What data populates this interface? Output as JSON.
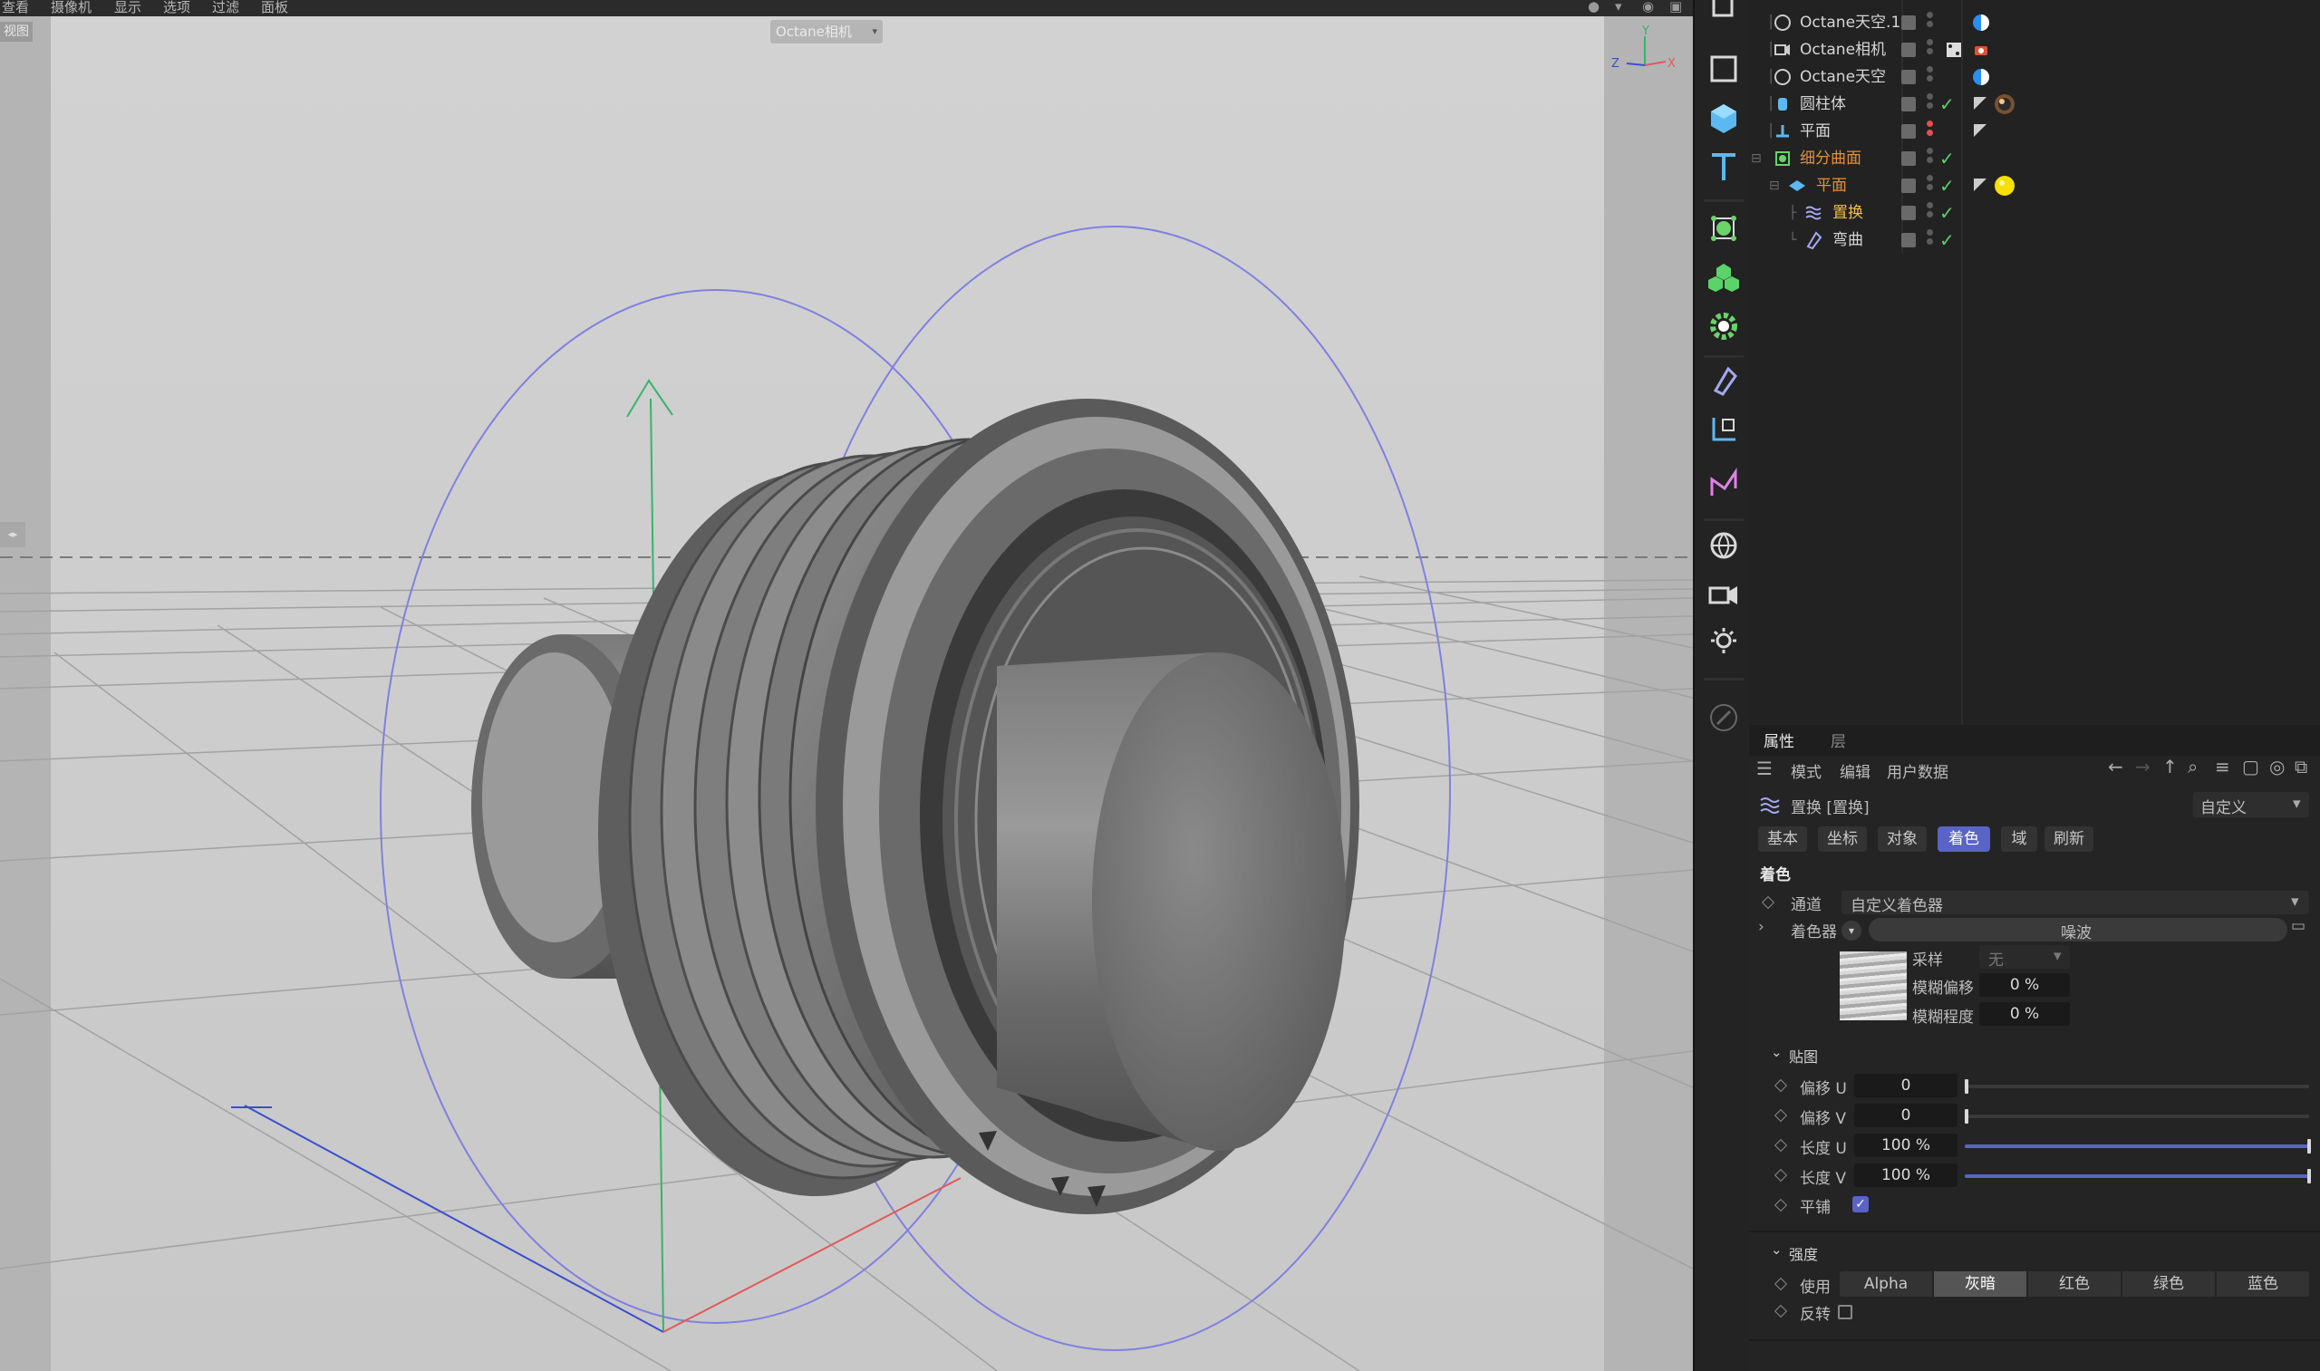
{
  "menubar": {
    "items": [
      "查看",
      "摄像机",
      "显示",
      "选项",
      "过滤",
      "面板"
    ]
  },
  "viewport": {
    "label": "视图",
    "camera_pill": "Octane相机",
    "axis_labels": {
      "y": "Y",
      "z": "Z",
      "x": "X"
    }
  },
  "toolbar": {
    "icons": [
      "select-icon",
      "rectangle-icon",
      "cube-icon",
      "text-icon",
      "subdivision-icon",
      "cloner-icon",
      "gear-effector-icon",
      "deformer-icon",
      "coordinate-icon",
      "spline-icon",
      "environment-icon",
      "camera-icon",
      "light-icon",
      "brush-icon"
    ]
  },
  "objects": [
    {
      "name": "Octane天空.1",
      "icon": "sky-icon",
      "tag": "octane-tag-blue"
    },
    {
      "name": "Octane相机",
      "icon": "camera-icon",
      "tag": "camera-tag-red"
    },
    {
      "name": "Octane天空",
      "icon": "sky-icon",
      "tag": "octane-tag-blue"
    },
    {
      "name": "圆柱体",
      "icon": "cylinder-icon",
      "tag": "material-tag"
    },
    {
      "name": "平面",
      "icon": "null-icon",
      "tag": "phong-tag"
    },
    {
      "name": "细分曲面",
      "icon": "subdivision-icon",
      "tag": ""
    },
    {
      "name": "平面",
      "icon": "plane-icon",
      "tag": "material-tag-yellow"
    },
    {
      "name": "置换",
      "icon": "displacer-icon",
      "tag": ""
    },
    {
      "name": "弯曲",
      "icon": "bend-icon",
      "tag": ""
    }
  ],
  "attributes": {
    "tabs": [
      "属性",
      "层"
    ],
    "menu": [
      "模式",
      "编辑",
      "用户数据"
    ],
    "object_title": "置换 [置换]",
    "preset": "自定义",
    "subtabs": [
      "基本",
      "坐标",
      "对象",
      "着色",
      "域",
      "刷新"
    ],
    "active_subtab": "着色",
    "section_title": "着色",
    "channel_label": "通道",
    "channel_value": "自定义着色器",
    "shader_label": "着色器",
    "shader_value": "噪波",
    "sample_label": "采样",
    "sample_value": "无",
    "blur_offset_label": "模糊偏移",
    "blur_offset_value": "0 %",
    "blur_scale_label": "模糊程度",
    "blur_scale_value": "0 %",
    "mapping_title": "贴图",
    "offset_u_label": "偏移 U",
    "offset_u_value": "0",
    "offset_v_label": "偏移 V",
    "offset_v_value": "0",
    "length_u_label": "长度 U",
    "length_u_value": "100 %",
    "length_v_label": "长度 V",
    "length_v_value": "100 %",
    "tile_label": "平铺",
    "tile_checked": true,
    "strength_title": "强度",
    "use_label": "使用",
    "use_options": [
      "Alpha",
      "灰暗",
      "红色",
      "绿色",
      "蓝色"
    ],
    "use_active": "灰暗",
    "invert_label": "反转",
    "invert_checked": false
  },
  "colors": {
    "accent": "#5a63c6",
    "check_green": "#55d36a",
    "object_orange": "#e2913a",
    "object_gold": "#f0c040"
  }
}
